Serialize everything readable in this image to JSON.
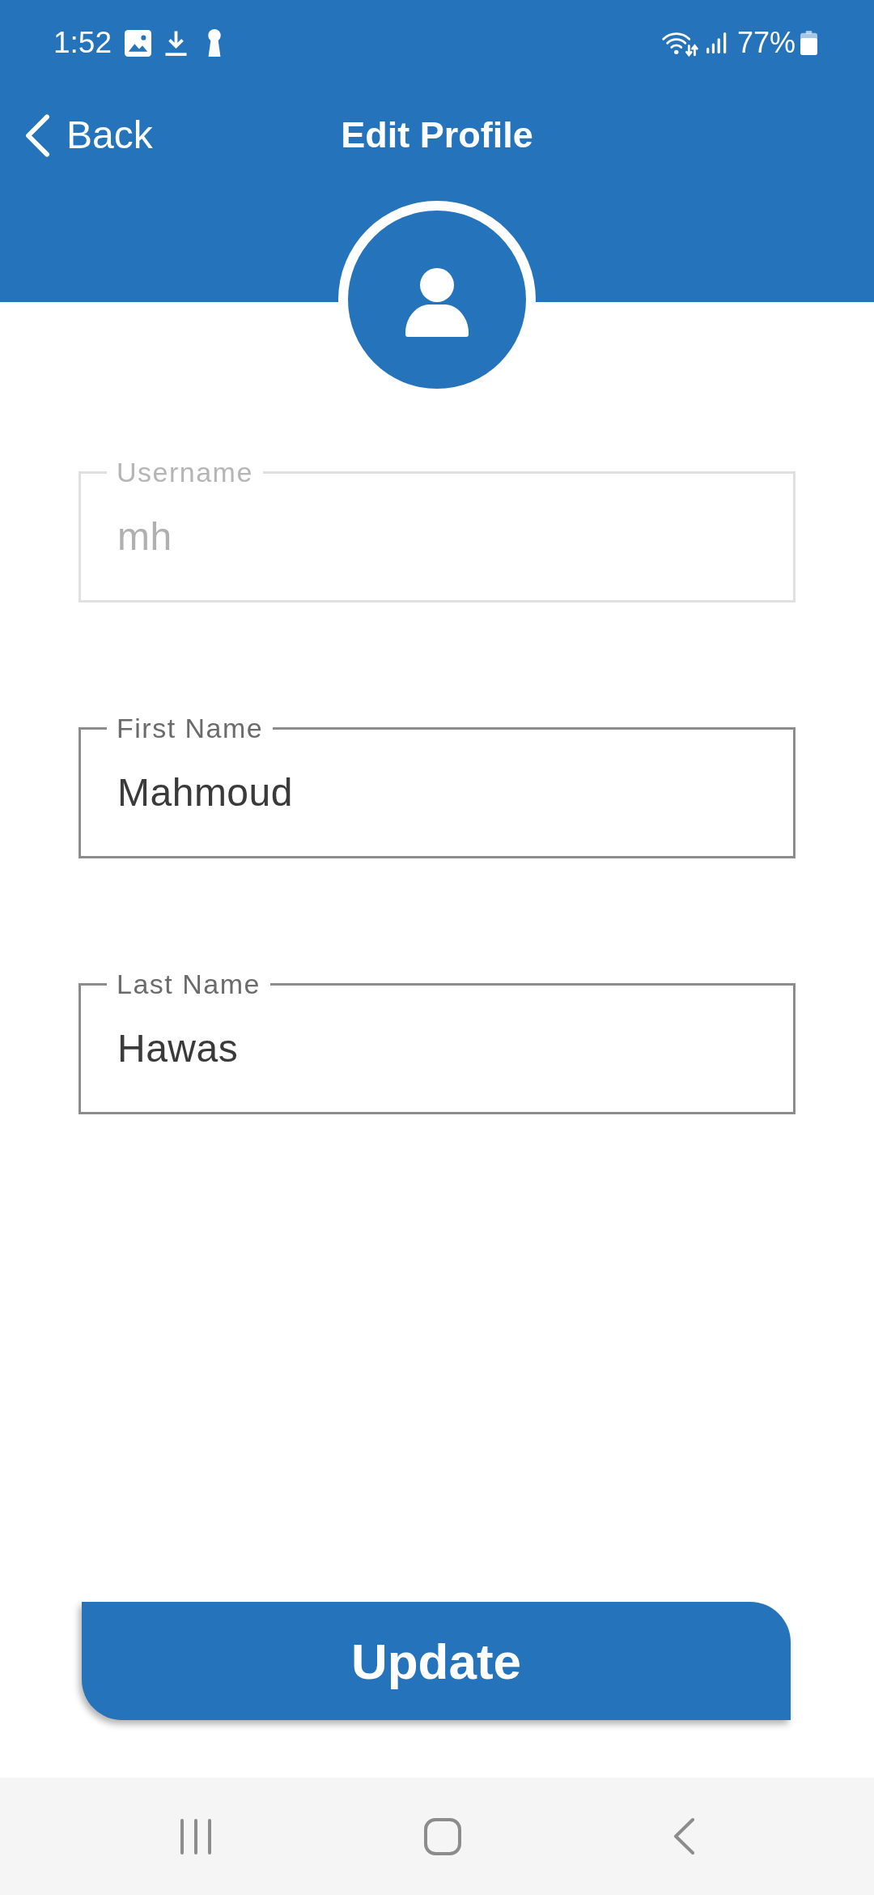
{
  "status_bar": {
    "time": "1:52",
    "battery_percent": "77%"
  },
  "header": {
    "back_label": "Back",
    "title": "Edit Profile"
  },
  "form": {
    "fields": [
      {
        "label": "Username",
        "value": "mh",
        "disabled": true
      },
      {
        "label": "First Name",
        "value": "Mahmoud",
        "disabled": false
      },
      {
        "label": "Last Name",
        "value": "Hawas",
        "disabled": false
      }
    ]
  },
  "update_button": {
    "label": "Update"
  }
}
